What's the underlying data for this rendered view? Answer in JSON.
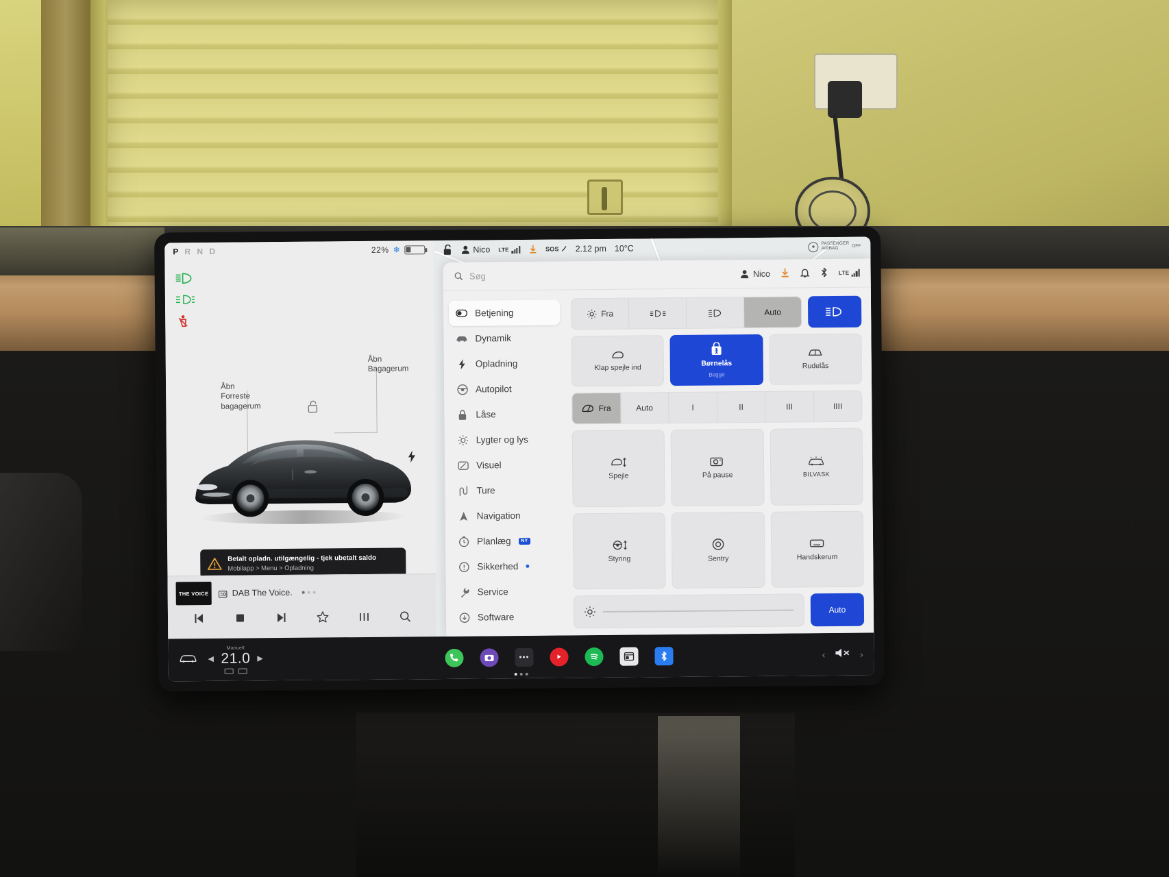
{
  "left_panel": {
    "gear_indicator": "P R N D",
    "gear_active": "P",
    "battery_percent": "22%",
    "snowflake_icon": "snowflake-icon",
    "telltales": [
      "low-beam-green-icon",
      "front-fog-green-icon",
      "seatbelt-red-icon"
    ],
    "callouts": {
      "frunk": "Åbn\nForreste\nbagagerum",
      "frunk_line1": "Åbn",
      "frunk_line2": "Forreste",
      "frunk_line3": "bagagerum",
      "trunk_line1": "Åbn",
      "trunk_line2": "Bagagerum"
    },
    "warning": {
      "icon": "warning-triangle-icon",
      "title": "Betalt opladn. utilgængelig - tjek ubetalt saldo",
      "subtitle": "Mobilapp > Menu > Opladning"
    },
    "media": {
      "art_label": "THE VOICE",
      "source_icon": "radio-icon",
      "title": "DAB The Voice.",
      "controls": [
        "prev-track-icon",
        "stop-icon",
        "next-track-icon",
        "favorite-star-icon",
        "equalizer-icon",
        "search-icon"
      ]
    }
  },
  "status_bar": {
    "lock_icon": "unlocked-padlock-icon",
    "profile_icon": "person-icon",
    "profile_name": "Nico",
    "network_label": "LTE",
    "signal_icon": "signal-bars-icon",
    "download_icon": "download-arrow-icon",
    "sos_label": "SOS",
    "time": "2.12 pm",
    "temperature": "10°C",
    "airbag_icon": "passenger-airbag-icon",
    "airbag_line1": "PASSENGER",
    "airbag_line2": "AIRBAG",
    "airbag_status": "OFF"
  },
  "settings": {
    "search": {
      "icon": "search-icon",
      "placeholder": "Søg",
      "value": ""
    },
    "header_right": {
      "profile_icon": "person-icon",
      "profile_name": "Nico",
      "download_icon": "download-arrow-icon",
      "bell_icon": "bell-icon",
      "bluetooth_icon": "bluetooth-icon",
      "network_label": "LTE",
      "signal_icon": "signal-bars-icon"
    },
    "nav_items": [
      {
        "label": "Betjening",
        "icon": "toggle-switch-icon",
        "active": true
      },
      {
        "label": "Dynamik",
        "icon": "car-side-icon",
        "active": false
      },
      {
        "label": "Opladning",
        "icon": "bolt-icon",
        "active": false
      },
      {
        "label": "Autopilot",
        "icon": "steering-wheel-icon",
        "active": false
      },
      {
        "label": "Låse",
        "icon": "padlock-icon",
        "active": false
      },
      {
        "label": "Lygter og lys",
        "icon": "sun-icon",
        "active": false
      },
      {
        "label": "Visuel",
        "icon": "display-icon",
        "active": false
      },
      {
        "label": "Ture",
        "icon": "road-icon",
        "active": false
      },
      {
        "label": "Navigation",
        "icon": "navigation-arrow-icon",
        "active": false
      },
      {
        "label": "Planlæg",
        "icon": "clock-icon",
        "active": false,
        "badge": "NY"
      },
      {
        "label": "Sikkerhed",
        "icon": "exclamation-circle-icon",
        "active": false,
        "dot": true
      },
      {
        "label": "Service",
        "icon": "wrench-icon",
        "active": false
      },
      {
        "label": "Software",
        "icon": "download-circle-icon",
        "active": false
      }
    ],
    "light_segment": {
      "options": [
        {
          "label": "Fra",
          "icon": "sun-icon",
          "on": false
        },
        {
          "label": "",
          "icon": "park-lights-icon",
          "on": false
        },
        {
          "label": "",
          "icon": "low-beam-icon",
          "on": false
        },
        {
          "label": "Auto",
          "icon": "",
          "on": true
        }
      ],
      "high_beam": {
        "icon": "high-beam-icon",
        "on": true
      }
    },
    "mirror_row": [
      {
        "label": "Klap spejle ind",
        "sub": "",
        "icon": "mirror-fold-icon",
        "on": false
      },
      {
        "label": "Børnelås",
        "sub": "Begge",
        "icon": "child-lock-icon",
        "on": true
      },
      {
        "label": "Rudelås",
        "sub": "",
        "icon": "window-lock-icon",
        "on": false
      }
    ],
    "wiper_segment": {
      "options": [
        {
          "label": "Fra",
          "icon": "wiper-icon",
          "on": true
        },
        {
          "label": "Auto",
          "icon": "",
          "on": false
        },
        {
          "label": "I",
          "icon": "",
          "on": false
        },
        {
          "label": "II",
          "icon": "",
          "on": false
        },
        {
          "label": "III",
          "icon": "",
          "on": false
        },
        {
          "label": "IIII",
          "icon": "",
          "on": false
        }
      ]
    },
    "tiles": [
      {
        "label": "Spejle",
        "icon": "mirror-adjust-icon",
        "on": false
      },
      {
        "label": "På pause",
        "icon": "camera-pause-icon",
        "on": false
      },
      {
        "label": "BILVASK",
        "icon": "car-wash-icon",
        "on": false,
        "caps": true
      },
      {
        "label": "Styring",
        "icon": "steering-adjust-icon",
        "on": false
      },
      {
        "label": "Sentry",
        "icon": "sentry-circle-icon",
        "on": false
      },
      {
        "label": "Handskerum",
        "icon": "glovebox-icon",
        "on": false
      }
    ],
    "brightness": {
      "icon": "brightness-icon",
      "value_percent": 6,
      "auto_label": "Auto",
      "auto_on": true
    }
  },
  "dock": {
    "car_icon": "car-front-icon",
    "climate_mode": "Manuelt",
    "temperature": "21.0",
    "seat_left_icon": "seat-icon",
    "seat_right_icon": "seat-icon",
    "apps": [
      {
        "name": "phone-app",
        "icon": "phone-icon",
        "color": "#3ec55a"
      },
      {
        "name": "camera-app",
        "icon": "camera-icon",
        "color": "#6d4ab8"
      },
      {
        "name": "more-apps",
        "icon": "dots-icon",
        "color": "#2b2b30"
      },
      {
        "name": "youtube-app",
        "icon": "play-icon",
        "color": "#e3222a"
      },
      {
        "name": "spotify-app",
        "icon": "spotify-icon",
        "color": "#1db954"
      },
      {
        "name": "browser-app",
        "icon": "browser-icon",
        "color": "#e8e8ea"
      },
      {
        "name": "bluetooth-app",
        "icon": "bluetooth-icon",
        "color": "#2a7cf0"
      }
    ],
    "volume": {
      "icon": "mute-icon",
      "left_chevron": "‹",
      "right_chevron": "›"
    }
  }
}
